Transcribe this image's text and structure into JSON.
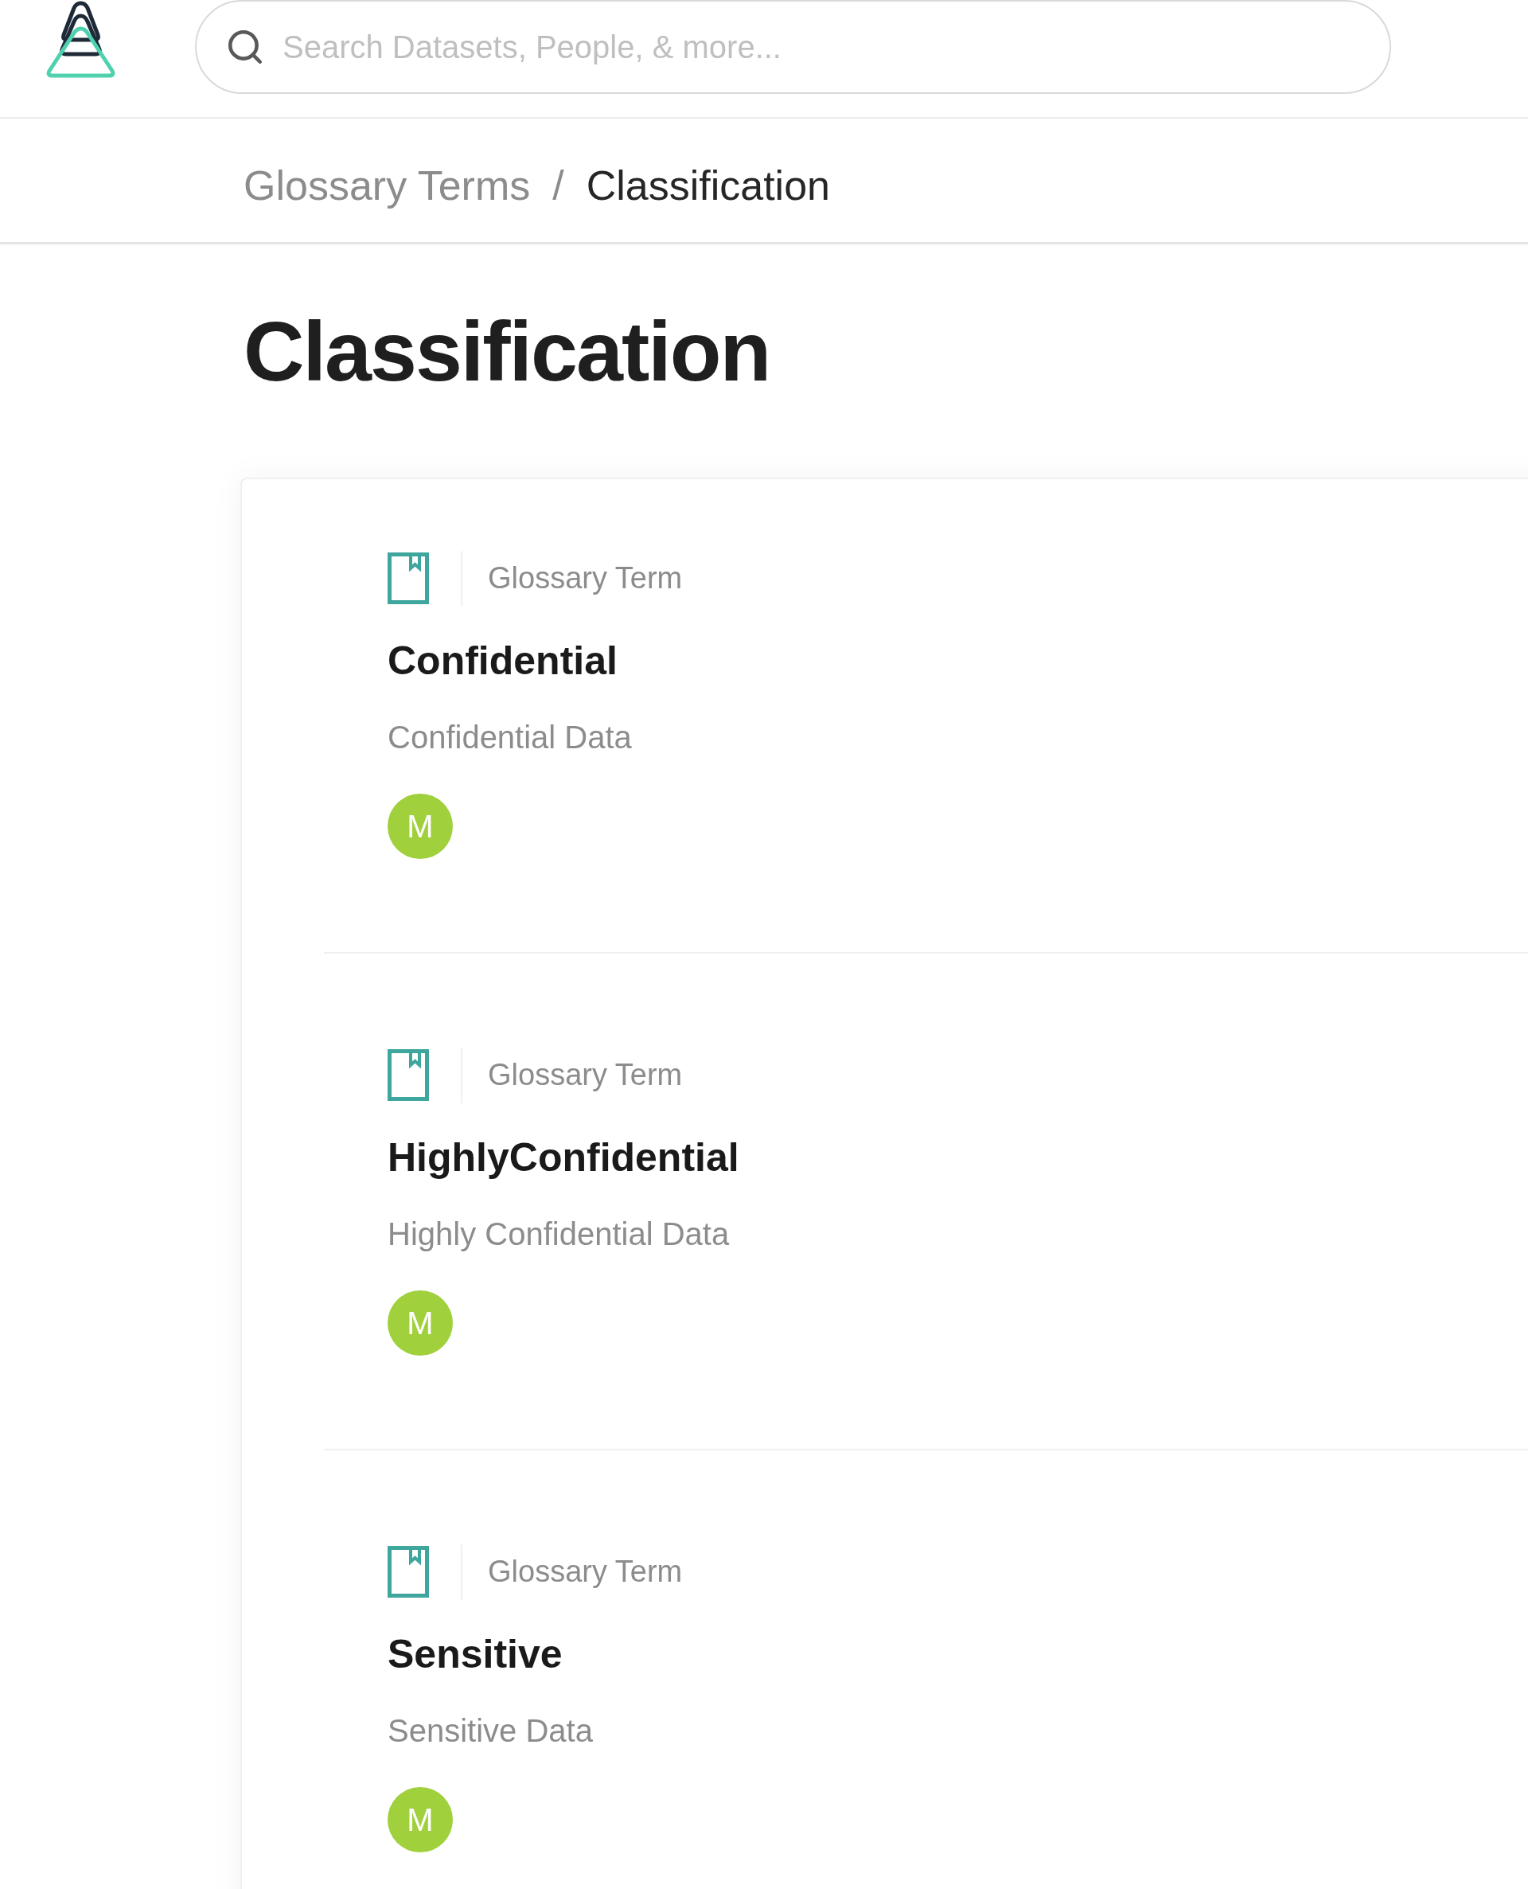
{
  "header": {
    "search": {
      "placeholder": "Search Datasets, People, & more..."
    }
  },
  "breadcrumb": {
    "separator": "/",
    "items": [
      {
        "label": "Glossary Terms",
        "current": false
      },
      {
        "label": "Classification",
        "current": true
      }
    ]
  },
  "page_title": "Classification",
  "terms": [
    {
      "type_label": "Glossary Term",
      "name": "Confidential",
      "description": "Confidential Data",
      "owners": [
        "M"
      ]
    },
    {
      "type_label": "Glossary Term",
      "name": "HighlyConfidential",
      "description": "Highly Confidential Data",
      "owners": [
        "M"
      ]
    },
    {
      "type_label": "Glossary Term",
      "name": "Sensitive",
      "description": "Sensitive Data",
      "owners": [
        "M"
      ]
    }
  ]
}
